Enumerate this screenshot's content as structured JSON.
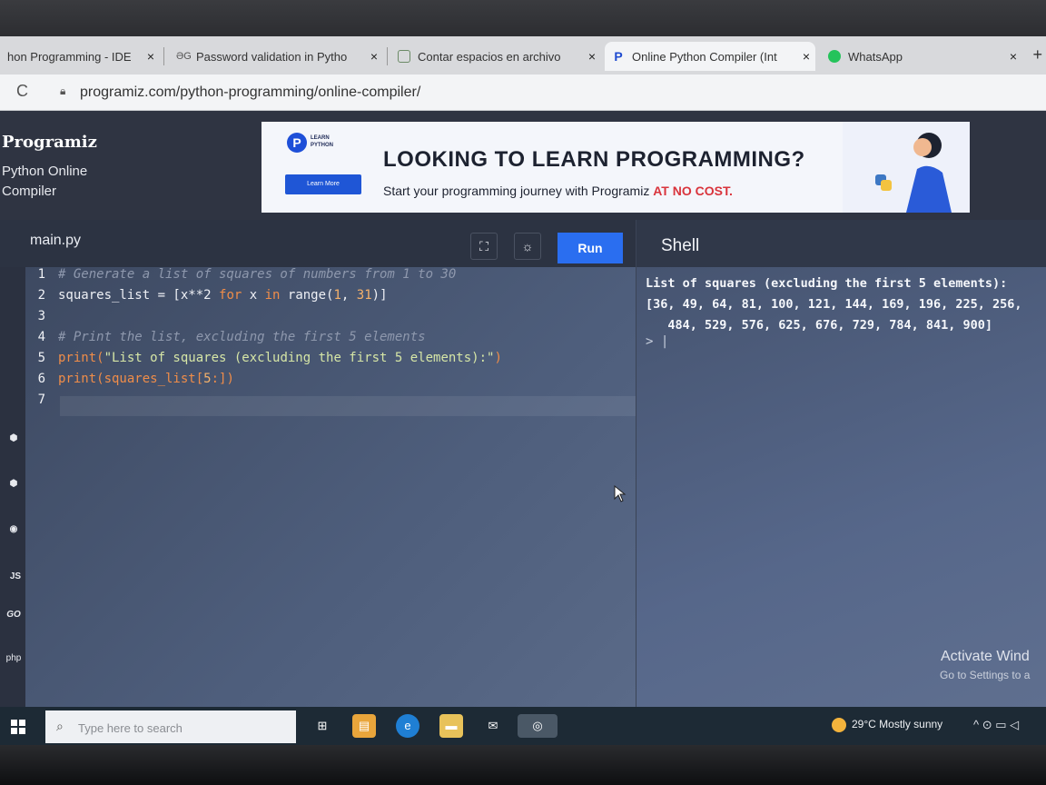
{
  "browser": {
    "tabs": [
      {
        "title": "hon Programming - IDE",
        "close": "×"
      },
      {
        "title": "Password validation in Pytho",
        "close": "×"
      },
      {
        "title": "Contar espacios en archivo",
        "close": "×"
      },
      {
        "title": "Online Python Compiler (Int",
        "close": "×"
      },
      {
        "title": "WhatsApp",
        "close": "×"
      }
    ],
    "new_tab": "+",
    "url": "programiz.com/python-programming/online-compiler/"
  },
  "site": {
    "logo": "Programiz",
    "subtitle_line1": "Python Online",
    "subtitle_line2": "Compiler"
  },
  "ad": {
    "badge": "P",
    "badge_text_line1": "LEARN",
    "badge_text_line2": "PYTHON",
    "button": "Learn More",
    "title": "LOOKING TO LEARN PROGRAMMING?",
    "subtitle": "Start your programming journey with Programiz ",
    "subtitle_highlight": "AT NO COST."
  },
  "editor": {
    "filename": "main.py",
    "run_label": "Run",
    "lines": {
      "n1": "1",
      "n2": "2",
      "n3": "3",
      "n4": "4",
      "n5": "5",
      "n6": "6",
      "n7": "7",
      "l1": "# Generate a list of squares of numbers from 1 to 30",
      "l2_a": "squares_list = [x**2 ",
      "l2_for": "for",
      "l2_b": " x ",
      "l2_in": "in",
      "l2_c": " range(",
      "l2_n1": "1",
      "l2_d": ", ",
      "l2_n2": "31",
      "l2_e": ")]",
      "l4": "# Print the list, excluding the first 5 elements",
      "l5_a": "print(",
      "l5_str": "\"List of squares (excluding the first 5 elements):\"",
      "l5_b": ")",
      "l6_a": "print(squares_list[",
      "l6_num": "5",
      "l6_b": ":])"
    }
  },
  "shell": {
    "title": "Shell",
    "output_line1": "List of squares (excluding the first 5 elements):",
    "output_line2": "[36, 49, 64, 81, 100, 121, 144, 169, 196, 225, 256,",
    "output_line3": "   484, 529, 576, 625, 676, 729, 784, 841, 900]",
    "prompt": "> |"
  },
  "sidebar": {
    "js": "JS",
    "go": "GO",
    "php": "php"
  },
  "watermark": {
    "line1": "Activate Wind",
    "line2": "Go to Settings to a"
  },
  "taskbar": {
    "search_placeholder": "Type here to search",
    "weather": "29°C  Mostly sunny"
  }
}
